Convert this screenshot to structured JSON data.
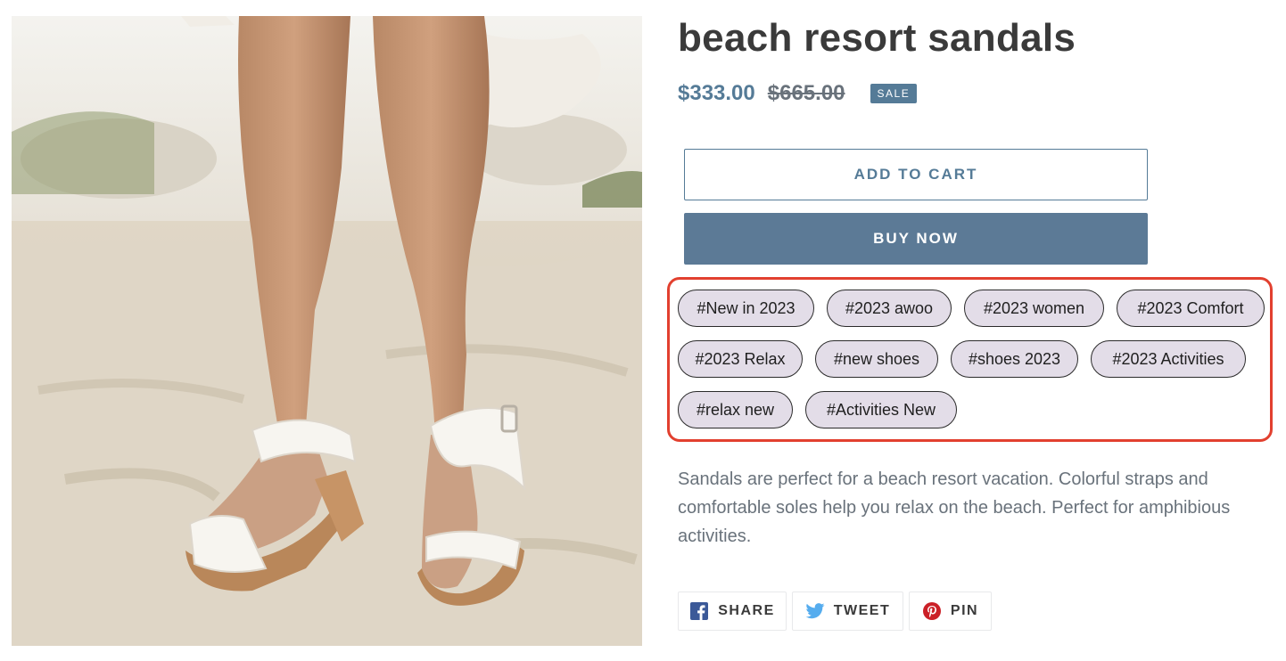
{
  "product": {
    "title": "beach resort sandals",
    "price_sale": "$333.00",
    "price_regular": "$665.00",
    "sale_badge": "SALE",
    "image_alt": "White ankle-tie sandals on beach sand",
    "description": "Sandals are perfect for a beach resort vacation. Colorful straps and comfortable soles help you relax on the beach. Perfect for amphibious activities."
  },
  "buttons": {
    "add_to_cart": "ADD TO CART",
    "buy_now": "BUY NOW"
  },
  "tags": [
    "#New in 2023",
    "#2023 awoo",
    "#2023 women",
    "#2023 Comfort",
    "#2023 Relax",
    "#new shoes",
    "#shoes 2023",
    "#2023 Activities",
    "#relax new",
    "#Activities New"
  ],
  "share": {
    "facebook": "SHARE",
    "twitter": "TWEET",
    "pinterest": "PIN"
  },
  "colors": {
    "accent": "#557b97",
    "highlight_border": "#e2402f",
    "tag_background": "#e3dde8",
    "facebook": "#3b5998",
    "twitter": "#55acee",
    "pinterest": "#cb2027"
  }
}
